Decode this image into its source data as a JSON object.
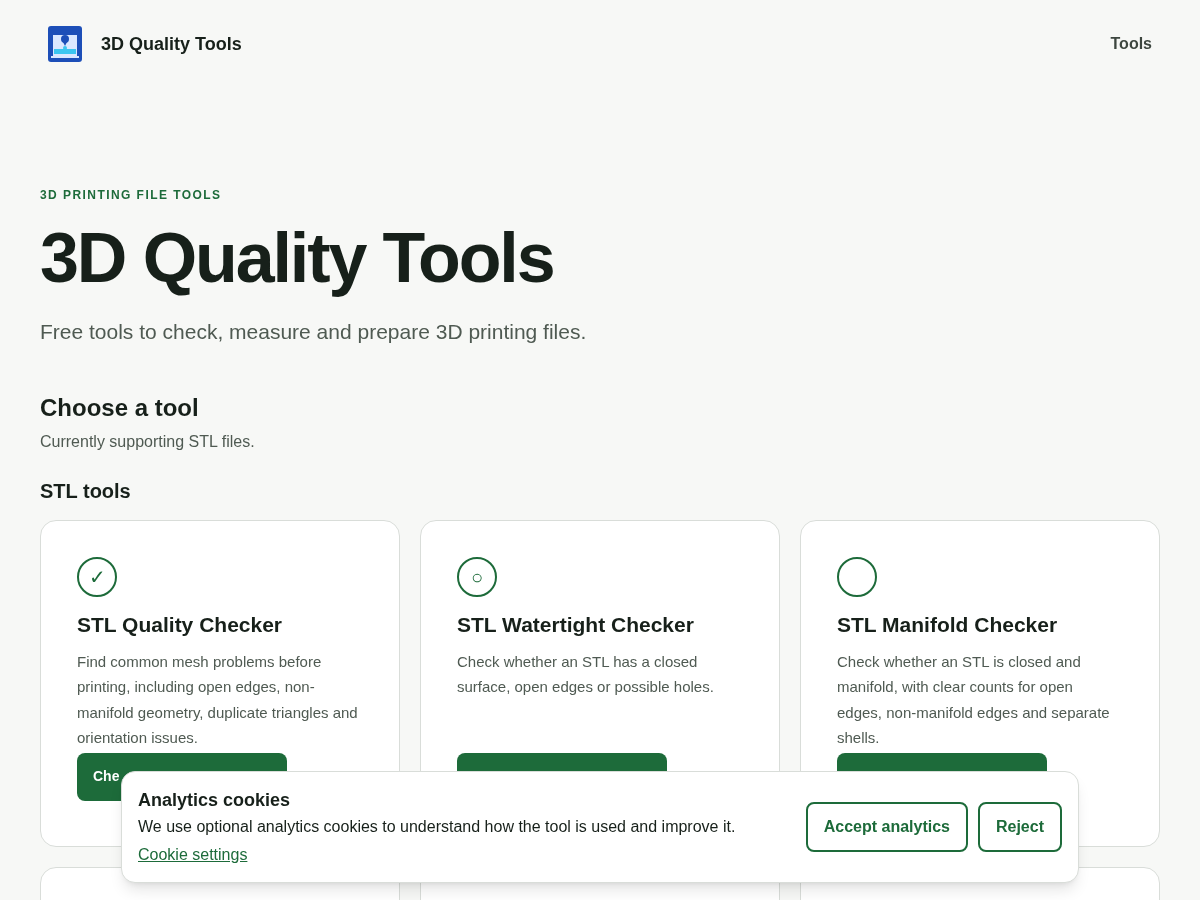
{
  "header": {
    "brand": "3D Quality Tools",
    "nav": [
      "Tools"
    ]
  },
  "hero": {
    "eyebrow": "3D PRINTING FILE TOOLS",
    "title": "3D Quality Tools",
    "subtitle": "Free tools to check, measure and prepare 3D printing files."
  },
  "section": {
    "title": "Choose a tool",
    "subtitle": "Currently supporting STL files.",
    "group_title": "STL tools"
  },
  "cards": [
    {
      "icon": "✓",
      "title": "STL Quality Checker",
      "description": "Find common mesh problems before printing, including open edges, non-manifold geometry, duplicate triangles and orientation issues.",
      "button": "Che"
    },
    {
      "icon": "○",
      "title": "STL Watertight Checker",
      "description": "Check whether an STL has a closed surface, open edges or possible holes."
    },
    {
      "title": "STL Manifold Checker",
      "description": "Check whether an STL is closed and manifold, with clear counts for open edges, non-manifold edges and separate shells."
    }
  ],
  "cookie_banner": {
    "title": "Analytics cookies",
    "text": "We use optional analytics cookies to understand how the tool is used and improve it.",
    "link": "Cookie settings",
    "buttons": [
      "Accept analytics",
      "Reject"
    ]
  }
}
